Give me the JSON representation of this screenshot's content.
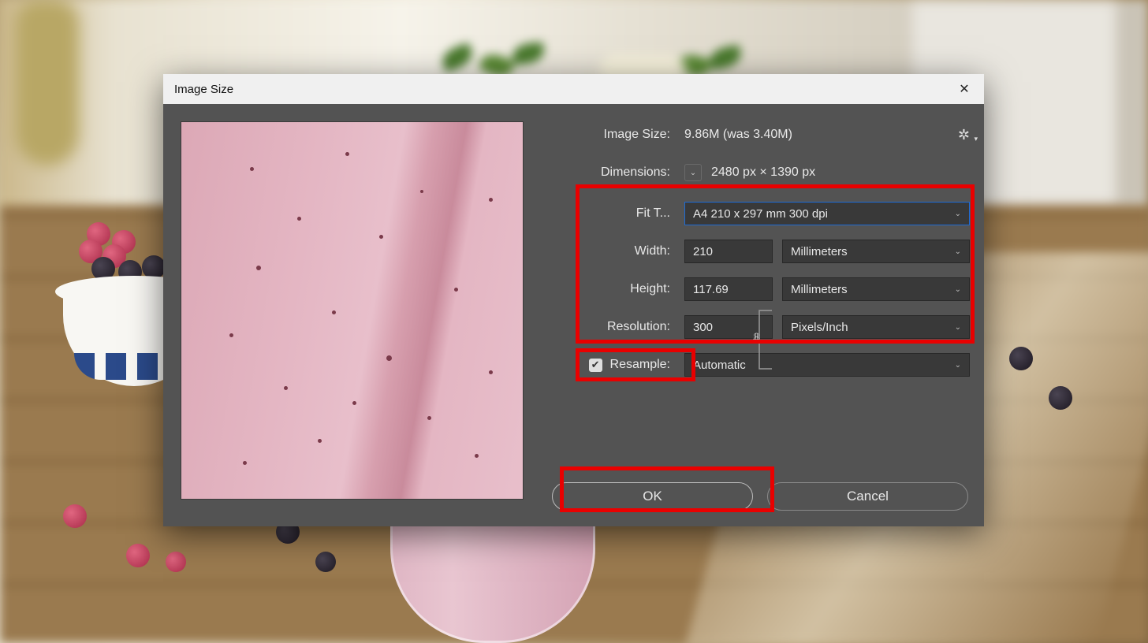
{
  "dialog": {
    "title": "Image Size",
    "image_size_label": "Image Size:",
    "image_size_value": "9.86M (was 3.40M)",
    "dimensions_label": "Dimensions:",
    "dimensions_value": "2480 px  ×  1390 px",
    "fitto_label": "Fit T...",
    "fitto_value": "A4 210 x 297 mm 300 dpi",
    "width_label": "Width:",
    "width_value": "210",
    "width_unit": "Millimeters",
    "height_label": "Height:",
    "height_value": "117.69",
    "height_unit": "Millimeters",
    "resolution_label": "Resolution:",
    "resolution_value": "300",
    "resolution_unit": "Pixels/Inch",
    "resample_label": "Resample:",
    "resample_checked": true,
    "resample_method": "Automatic",
    "ok_label": "OK",
    "cancel_label": "Cancel"
  }
}
